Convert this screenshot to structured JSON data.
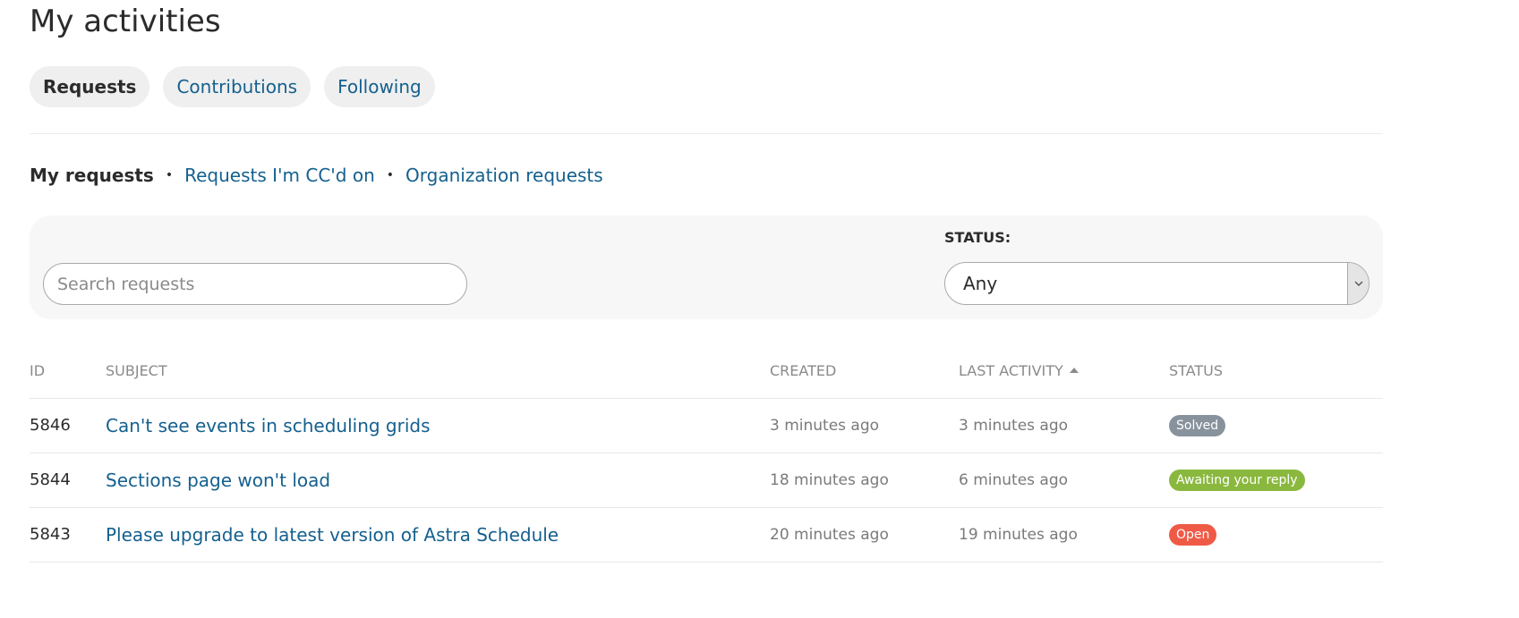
{
  "page": {
    "title": "My activities"
  },
  "tabs": [
    {
      "label": "Requests",
      "active": true
    },
    {
      "label": "Contributions",
      "active": false
    },
    {
      "label": "Following",
      "active": false
    }
  ],
  "subnav": [
    {
      "label": "My requests",
      "current": true
    },
    {
      "label": "Requests I'm CC'd on",
      "current": false
    },
    {
      "label": "Organization requests",
      "current": false
    }
  ],
  "filters": {
    "search_placeholder": "Search requests",
    "status_label": "STATUS:",
    "status_value": "Any"
  },
  "table": {
    "headers": {
      "id": "ID",
      "subject": "SUBJECT",
      "created": "CREATED",
      "last_activity": "LAST ACTIVITY",
      "status": "STATUS"
    },
    "rows": [
      {
        "id": "5846",
        "subject": "Can't see events in scheduling grids",
        "created": "3 minutes ago",
        "last_activity": "3 minutes ago",
        "status": "Solved",
        "status_color": "#87929d"
      },
      {
        "id": "5844",
        "subject": "Sections page won't load",
        "created": "18 minutes ago",
        "last_activity": "6 minutes ago",
        "status": "Awaiting your reply",
        "status_color": "#8ab83e"
      },
      {
        "id": "5843",
        "subject": "Please upgrade to latest version of Astra Schedule",
        "created": "20 minutes ago",
        "last_activity": "19 minutes ago",
        "status": "Open",
        "status_color": "#ef5a46"
      }
    ]
  },
  "icons": {
    "sort": "sort-ascending-icon",
    "dropdown": "chevron-down-icon"
  }
}
